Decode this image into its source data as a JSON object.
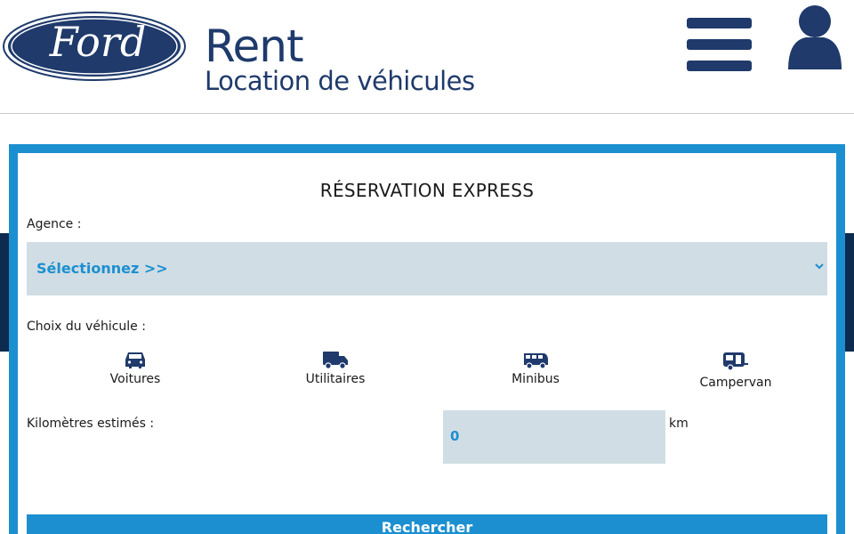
{
  "header": {
    "logo_text": "Ford",
    "brand_title": "Rent",
    "brand_subtitle": "Location de véhicules",
    "menu_icon": "hamburger-menu-icon",
    "user_icon": "user-icon"
  },
  "colors": {
    "brand_navy": "#1f3a6b",
    "accent_blue": "#1c8fd0",
    "field_bg": "#d0dde4"
  },
  "form": {
    "title": "RÉSERVATION EXPRESS",
    "agence_label": "Agence :",
    "agence_selected": "Sélectionnez >>",
    "vehicle_label": "Choix du véhicule :",
    "vehicles": [
      {
        "label": "Voitures",
        "icon": "car-icon"
      },
      {
        "label": "Utilitaires",
        "icon": "truck-icon"
      },
      {
        "label": "Minibus",
        "icon": "minibus-icon"
      },
      {
        "label": "Campervan",
        "icon": "caravan-icon"
      }
    ],
    "km_label": "Kilomètres estimés :",
    "km_value": "0",
    "km_unit": "km",
    "search_label": "Rechercher"
  }
}
